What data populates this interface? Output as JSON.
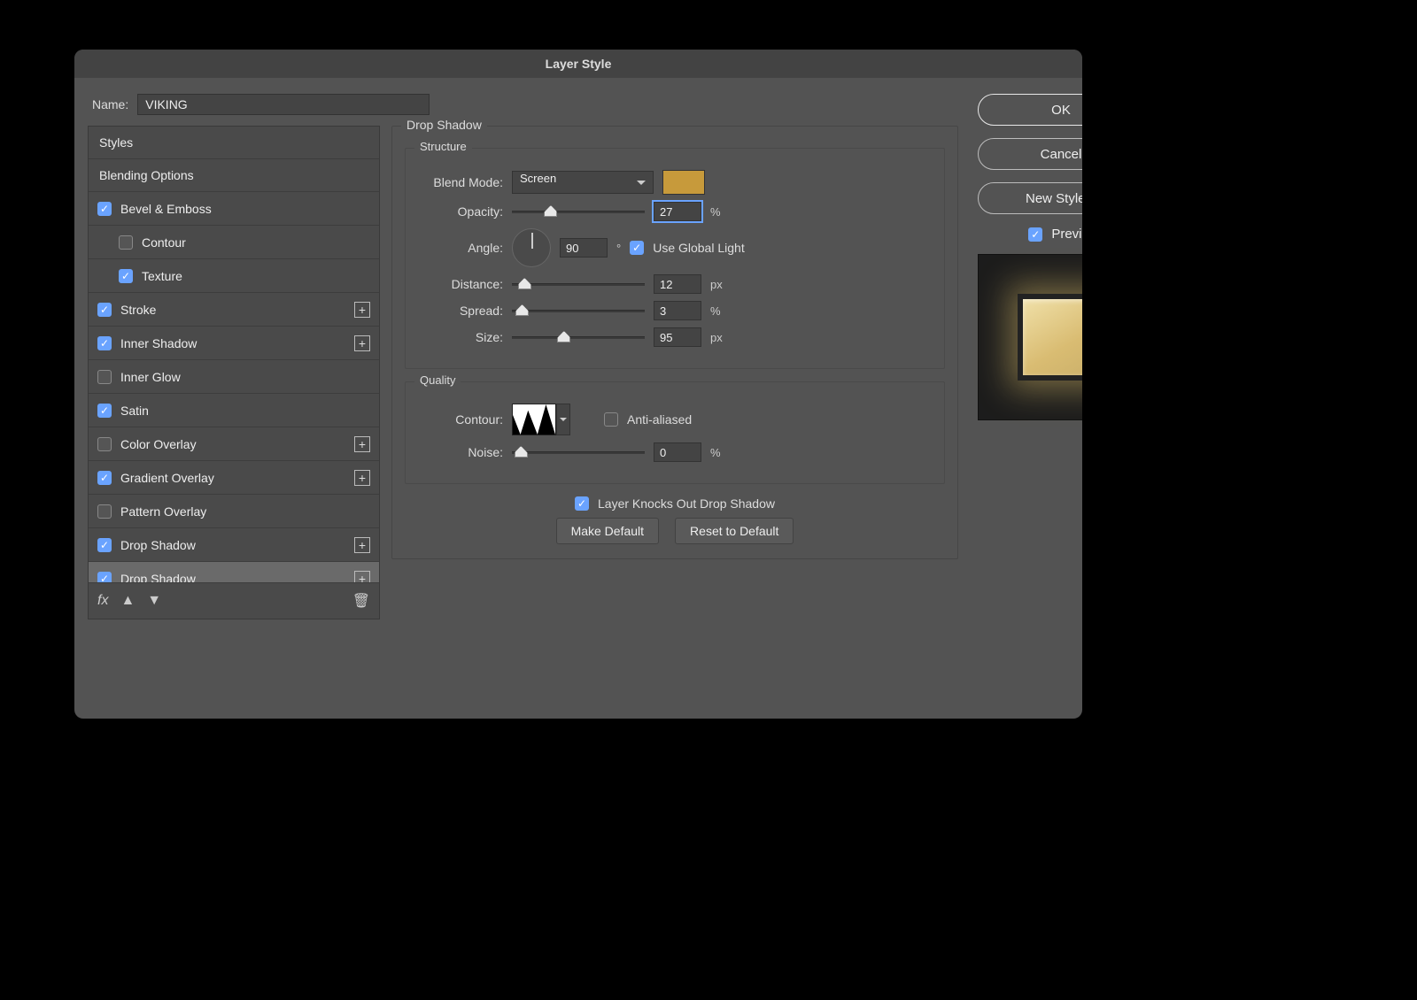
{
  "title": "Layer Style",
  "name_label": "Name:",
  "name_value": "VIKING",
  "styles_header": "Styles",
  "blending_options": "Blending Options",
  "styles": [
    {
      "label": "Bevel & Emboss",
      "checked": true,
      "add": false,
      "indent": false
    },
    {
      "label": "Contour",
      "checked": false,
      "add": false,
      "indent": true
    },
    {
      "label": "Texture",
      "checked": true,
      "add": false,
      "indent": true
    },
    {
      "label": "Stroke",
      "checked": true,
      "add": true,
      "indent": false
    },
    {
      "label": "Inner Shadow",
      "checked": true,
      "add": true,
      "indent": false
    },
    {
      "label": "Inner Glow",
      "checked": false,
      "add": false,
      "indent": false
    },
    {
      "label": "Satin",
      "checked": true,
      "add": false,
      "indent": false
    },
    {
      "label": "Color Overlay",
      "checked": false,
      "add": true,
      "indent": false
    },
    {
      "label": "Gradient Overlay",
      "checked": true,
      "add": true,
      "indent": false
    },
    {
      "label": "Pattern Overlay",
      "checked": false,
      "add": false,
      "indent": false
    },
    {
      "label": "Drop Shadow",
      "checked": true,
      "add": true,
      "indent": false
    },
    {
      "label": "Drop Shadow",
      "checked": true,
      "add": true,
      "indent": false,
      "selected": true
    }
  ],
  "section_title": "Drop Shadow",
  "structure": {
    "legend": "Structure",
    "blend_mode_label": "Blend Mode:",
    "blend_mode_value": "Screen",
    "color": "#c79a3b",
    "opacity_label": "Opacity:",
    "opacity_value": "27",
    "opacity_unit": "%",
    "angle_label": "Angle:",
    "angle_value": "90",
    "angle_unit": "°",
    "global_light_label": "Use Global Light",
    "global_light_checked": true,
    "distance_label": "Distance:",
    "distance_value": "12",
    "distance_unit": "px",
    "spread_label": "Spread:",
    "spread_value": "3",
    "spread_unit": "%",
    "size_label": "Size:",
    "size_value": "95",
    "size_unit": "px"
  },
  "quality": {
    "legend": "Quality",
    "contour_label": "Contour:",
    "anti_aliased_label": "Anti-aliased",
    "anti_aliased_checked": false,
    "noise_label": "Noise:",
    "noise_value": "0",
    "noise_unit": "%"
  },
  "knockout_label": "Layer Knocks Out Drop Shadow",
  "knockout_checked": true,
  "make_default": "Make Default",
  "reset_default": "Reset to Default",
  "buttons": {
    "ok": "OK",
    "cancel": "Cancel",
    "new_style": "New Style...",
    "preview": "Preview"
  },
  "slider_positions": {
    "opacity": 27,
    "distance": 5,
    "spread": 3,
    "size": 38,
    "noise": 2
  }
}
